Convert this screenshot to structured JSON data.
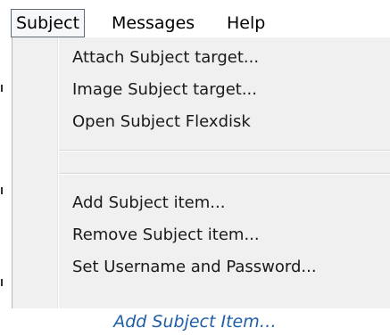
{
  "menubar": {
    "items": [
      {
        "label": "Subject",
        "active": true
      },
      {
        "label": "Messages",
        "active": false
      },
      {
        "label": "Help",
        "active": false
      }
    ]
  },
  "menu": {
    "group1": [
      "Attach Subject target...",
      "Image Subject target...",
      "Open Subject Flexdisk"
    ],
    "group2": [
      "Add Subject item...",
      "Remove Subject item...",
      "Set Username and Password..."
    ]
  },
  "caption": "Add Subject Item…"
}
